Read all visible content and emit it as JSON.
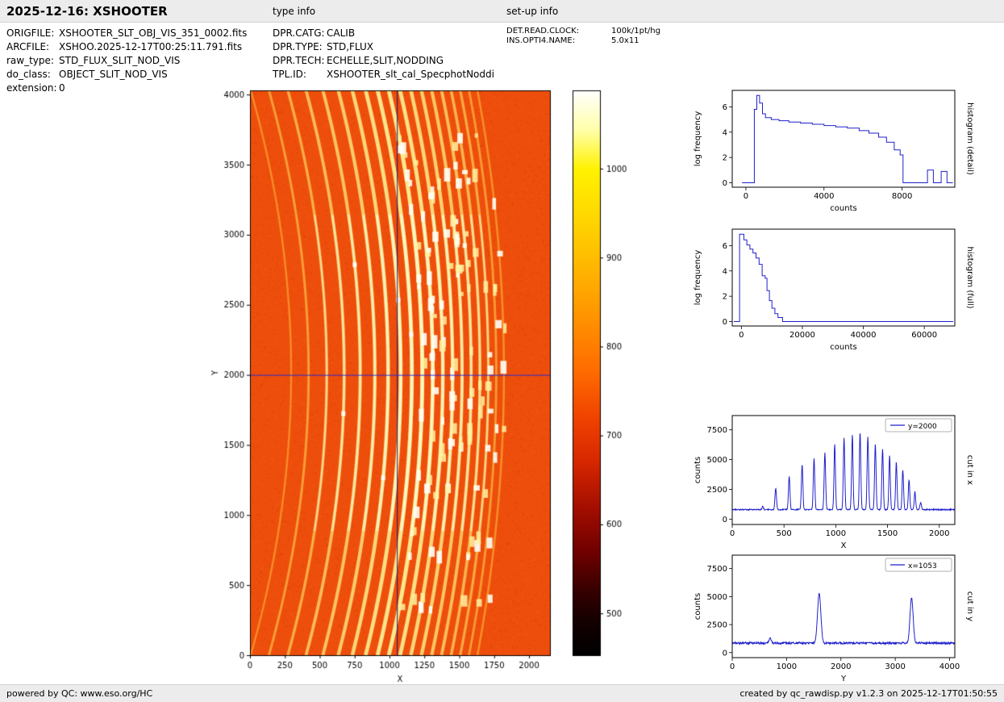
{
  "header": {
    "title": "2025-12-16: XSHOOTER",
    "type_info_label": "type info",
    "setup_info_label": "set-up info"
  },
  "metadata": {
    "left": [
      {
        "label": "ORIGFILE:",
        "value": "XSHOOTER_SLT_OBJ_VIS_351_0002.fits"
      },
      {
        "label": "ARCFILE:",
        "value": "XSHOO.2025-12-17T00:25:11.791.fits"
      },
      {
        "label": "raw_type:",
        "value": "STD_FLUX_SLIT_NOD_VIS"
      },
      {
        "label": "do_class:",
        "value": "OBJECT_SLIT_NOD_VIS"
      },
      {
        "label": "extension:",
        "value": "0"
      }
    ],
    "middle": [
      {
        "label": "DPR.CATG:",
        "value": "CALIB"
      },
      {
        "label": "DPR.TYPE:",
        "value": "STD,FLUX"
      },
      {
        "label": "DPR.TECH:",
        "value": "ECHELLE,SLIT,NODDING"
      },
      {
        "label": "TPL.ID:",
        "value": "XSHOOTER_slt_cal_SpecphotNoddi"
      }
    ],
    "right": [
      {
        "label": "DET.READ.CLOCK:",
        "value": "100k/1pt/hg"
      },
      {
        "label": "INS.OPTI4.NAME:",
        "value": "5.0x11"
      }
    ]
  },
  "footer": {
    "left": "powered by QC: www.eso.org/HC",
    "right": "created by qc_rawdisp.py v1.2.3 on 2025-12-17T01:50:55"
  },
  "chart_data": [
    {
      "id": "raw_frame",
      "type": "heatmap",
      "xlabel": "X",
      "ylabel": "Y",
      "xlim": [
        0,
        2150
      ],
      "ylim": [
        0,
        4030
      ],
      "xticks": [
        0,
        250,
        500,
        750,
        1000,
        1250,
        1500,
        1750,
        2000
      ],
      "yticks": [
        0,
        500,
        1000,
        1500,
        2000,
        2500,
        3000,
        3500,
        4000
      ],
      "crosshair": {
        "x": 1053,
        "y": 2000,
        "x_color": "#18186e",
        "y_color": "#2828cf"
      },
      "background_counts": 780,
      "base_color": "#ee4e0b",
      "echelle_orders": {
        "x_at_center": [
          295,
          420,
          550,
          675,
          790,
          895,
          990,
          1080,
          1160,
          1235,
          1310,
          1382,
          1452,
          1520,
          1585,
          1648,
          1708,
          1765,
          1820
        ],
        "peak_counts": [
          1200,
          2600,
          3600,
          4600,
          5100,
          5600,
          6300,
          6800,
          7100,
          7300,
          6900,
          6300,
          5900,
          5300,
          4800,
          4100,
          3300,
          2300,
          1400
        ],
        "curvature_max": 290,
        "curvature_min": 190
      },
      "colorbar": {
        "vmin": 453,
        "vmax": 1088,
        "ticks": [
          500,
          600,
          700,
          800,
          900,
          1000
        ],
        "gradient_stops": [
          [
            0,
            "#000000"
          ],
          [
            0.06,
            "#140000"
          ],
          [
            0.11,
            "#330000"
          ],
          [
            0.18,
            "#6e0000"
          ],
          [
            0.26,
            "#a30e00"
          ],
          [
            0.34,
            "#d62600"
          ],
          [
            0.42,
            "#f04300"
          ],
          [
            0.5,
            "#ff6a00"
          ],
          [
            0.58,
            "#ff8c00"
          ],
          [
            0.68,
            "#ffb400"
          ],
          [
            0.78,
            "#ffd900"
          ],
          [
            0.86,
            "#fff200"
          ],
          [
            0.93,
            "#ffffaa"
          ],
          [
            1,
            "#ffffff"
          ]
        ]
      }
    },
    {
      "id": "hist_detail",
      "type": "line",
      "xlabel": "counts",
      "ylabel": "log frequency",
      "side_label": "histogram (detail)",
      "xlim": [
        -700,
        10700
      ],
      "ylim": [
        -0.35,
        7.3
      ],
      "xticks": [
        0,
        4000,
        8000
      ],
      "yticks": [
        0,
        2,
        4,
        6
      ],
      "line_color": "#2020cc",
      "points": [
        [
          -200,
          0
        ],
        [
          430,
          0
        ],
        [
          430,
          5.8
        ],
        [
          560,
          5.8
        ],
        [
          560,
          6.9
        ],
        [
          700,
          6.9
        ],
        [
          700,
          6.3
        ],
        [
          850,
          6.3
        ],
        [
          850,
          5.45
        ],
        [
          1000,
          5.45
        ],
        [
          1000,
          5.15
        ],
        [
          1300,
          5.15
        ],
        [
          1300,
          5.0
        ],
        [
          1700,
          5.0
        ],
        [
          1700,
          4.9
        ],
        [
          2200,
          4.9
        ],
        [
          2200,
          4.8
        ],
        [
          2800,
          4.8
        ],
        [
          2800,
          4.72
        ],
        [
          3400,
          4.72
        ],
        [
          3400,
          4.62
        ],
        [
          4000,
          4.62
        ],
        [
          4000,
          4.52
        ],
        [
          4600,
          4.52
        ],
        [
          4600,
          4.42
        ],
        [
          5200,
          4.42
        ],
        [
          5200,
          4.32
        ],
        [
          5800,
          4.32
        ],
        [
          5800,
          4.12
        ],
        [
          6300,
          4.12
        ],
        [
          6300,
          3.92
        ],
        [
          6800,
          3.92
        ],
        [
          6800,
          3.6
        ],
        [
          7200,
          3.6
        ],
        [
          7200,
          3.2
        ],
        [
          7600,
          3.2
        ],
        [
          7600,
          2.6
        ],
        [
          7900,
          2.6
        ],
        [
          7900,
          2.2
        ],
        [
          8050,
          2.2
        ],
        [
          8050,
          0
        ],
        [
          9300,
          0
        ],
        [
          9300,
          1.0
        ],
        [
          9600,
          1.0
        ],
        [
          9600,
          0
        ],
        [
          10000,
          0
        ],
        [
          10000,
          0.9
        ],
        [
          10300,
          0.9
        ],
        [
          10300,
          0
        ],
        [
          10600,
          0
        ]
      ]
    },
    {
      "id": "hist_full",
      "type": "line",
      "xlabel": "counts",
      "ylabel": "log frequency",
      "side_label": "histogram (full)",
      "xlim": [
        -3000,
        70000
      ],
      "ylim": [
        -0.35,
        7.3
      ],
      "xticks": [
        0,
        20000,
        40000,
        60000
      ],
      "yticks": [
        0,
        2,
        4,
        6
      ],
      "line_color": "#2020cc",
      "points": [
        [
          -2500,
          0
        ],
        [
          -600,
          0
        ],
        [
          -600,
          6.9
        ],
        [
          800,
          6.9
        ],
        [
          800,
          6.45
        ],
        [
          1800,
          6.45
        ],
        [
          1800,
          6.05
        ],
        [
          2800,
          6.05
        ],
        [
          2800,
          5.72
        ],
        [
          3800,
          5.72
        ],
        [
          3800,
          5.42
        ],
        [
          4800,
          5.42
        ],
        [
          4800,
          5.02
        ],
        [
          5800,
          5.02
        ],
        [
          5800,
          4.52
        ],
        [
          6800,
          4.52
        ],
        [
          6800,
          3.62
        ],
        [
          7800,
          3.62
        ],
        [
          7800,
          3.42
        ],
        [
          8400,
          3.42
        ],
        [
          8400,
          2.45
        ],
        [
          9200,
          2.45
        ],
        [
          9200,
          1.65
        ],
        [
          10000,
          1.65
        ],
        [
          10000,
          1.05
        ],
        [
          11000,
          1.05
        ],
        [
          11000,
          0.62
        ],
        [
          12000,
          0.62
        ],
        [
          12000,
          0.32
        ],
        [
          13500,
          0.32
        ],
        [
          13500,
          0
        ],
        [
          69500,
          0
        ]
      ]
    },
    {
      "id": "cut_x",
      "type": "line",
      "legend": "y=2000",
      "xlabel": "X",
      "ylabel": "counts",
      "side_label": "cut in x",
      "xlim": [
        0,
        2150
      ],
      "ylim": [
        -450,
        8700
      ],
      "xticks": [
        0,
        500,
        1000,
        1500,
        2000
      ],
      "yticks": [
        0,
        2500,
        5000,
        7500
      ],
      "line_color": "#2020cc",
      "baseline": 800,
      "noise": 45,
      "peaks": [
        [
          295,
          1100,
          6
        ],
        [
          420,
          2600,
          7
        ],
        [
          550,
          3600,
          7
        ],
        [
          675,
          4600,
          7
        ],
        [
          790,
          5100,
          7
        ],
        [
          895,
          5600,
          7
        ],
        [
          990,
          6300,
          7
        ],
        [
          1080,
          6800,
          7
        ],
        [
          1160,
          7100,
          7
        ],
        [
          1235,
          7300,
          7
        ],
        [
          1310,
          6900,
          7
        ],
        [
          1382,
          6300,
          7
        ],
        [
          1452,
          5900,
          7
        ],
        [
          1520,
          5300,
          7
        ],
        [
          1585,
          4800,
          7
        ],
        [
          1648,
          4100,
          7
        ],
        [
          1708,
          3300,
          7
        ],
        [
          1765,
          2300,
          7
        ],
        [
          1820,
          1400,
          7
        ]
      ]
    },
    {
      "id": "cut_y",
      "type": "line",
      "legend": "x=1053",
      "xlabel": "Y",
      "ylabel": "counts",
      "side_label": "cut in y",
      "xlim": [
        0,
        4096
      ],
      "ylim": [
        -450,
        8700
      ],
      "xticks": [
        0,
        1000,
        2000,
        3000,
        4000
      ],
      "yticks": [
        0,
        2500,
        5000,
        7500
      ],
      "line_color": "#2020cc",
      "baseline": 850,
      "noise": 90,
      "peaks": [
        [
          700,
          1300,
          20
        ],
        [
          1600,
          5300,
          30
        ],
        [
          3300,
          4900,
          28
        ]
      ]
    }
  ]
}
